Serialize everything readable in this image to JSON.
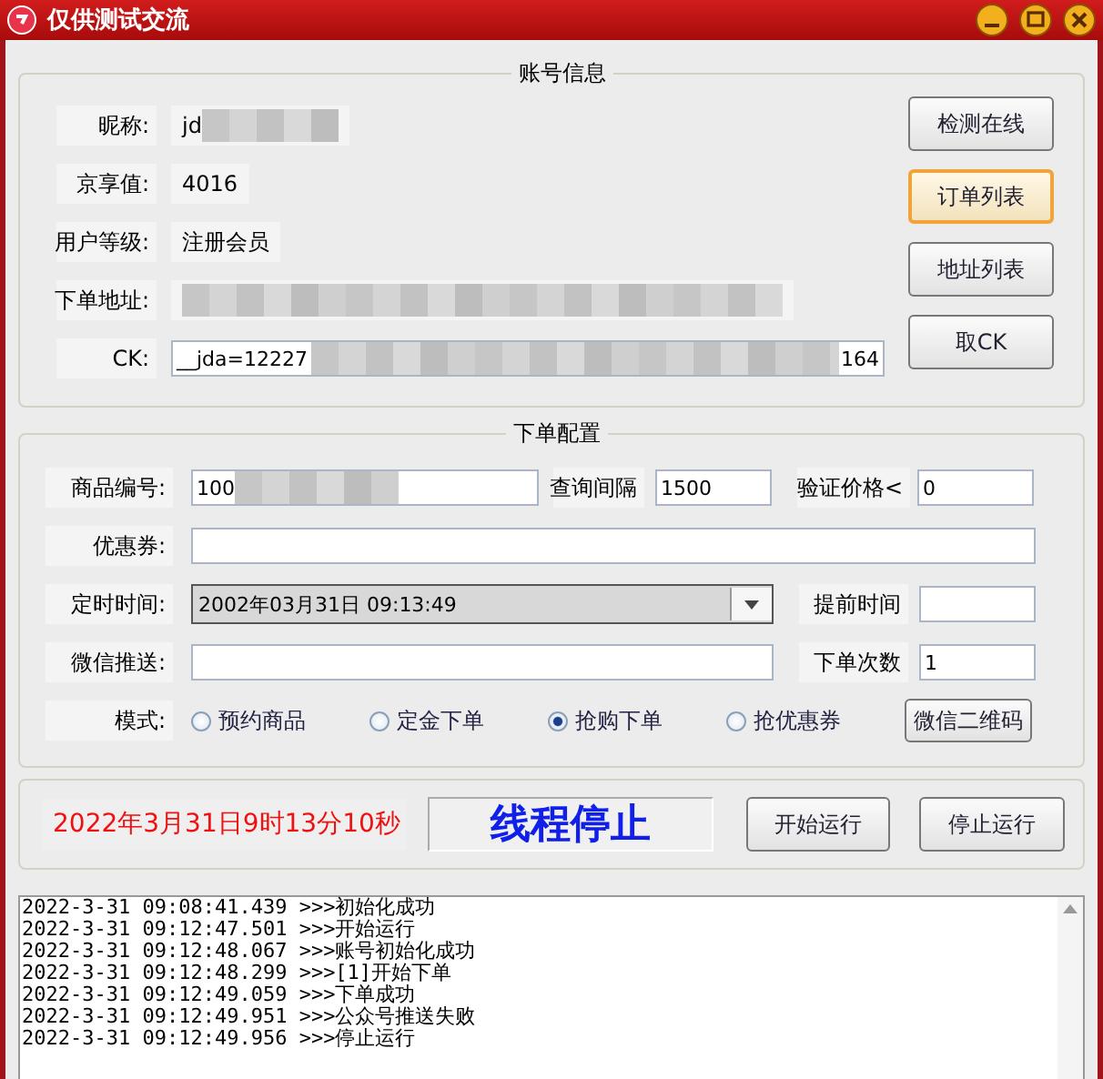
{
  "window": {
    "title": "仅供测试交流"
  },
  "account": {
    "title": "账号信息",
    "fields": [
      {
        "kind": "text",
        "label": "昵称:",
        "value": "jd",
        "redacted": true
      },
      {
        "kind": "text",
        "label": "京享值:",
        "value": "4016",
        "redacted": false
      },
      {
        "kind": "text",
        "label": "用户等级:",
        "value": "注册会员",
        "redacted": false
      },
      {
        "kind": "text",
        "label": "下单地址:",
        "redacted": true
      },
      {
        "kind": "input",
        "label": "CK:",
        "value": "__jda=12227",
        "value_end": "164",
        "redacted": true
      }
    ],
    "buttons": [
      {
        "label": "检测在线",
        "focused": false
      },
      {
        "label": "订单列表",
        "focused": true
      },
      {
        "label": "地址列表",
        "focused": false
      },
      {
        "label": "取CK",
        "focused": false
      }
    ]
  },
  "order": {
    "title": "下单配置",
    "product": {
      "label": "商品编号:",
      "value": "100",
      "redacted": true
    },
    "interval": {
      "label": "查询间隔",
      "value": "1500"
    },
    "price": {
      "label": "验证价格<",
      "value": "0"
    },
    "coupon": {
      "label": "优惠券:"
    },
    "timer": {
      "label": "定时时间:",
      "value": "2002年03月31日 09:13:49"
    },
    "advance": {
      "label": "提前时间"
    },
    "wechat": {
      "label": "微信推送:"
    },
    "count": {
      "label": "下单次数",
      "value": "1"
    },
    "mode": {
      "label": "模式:",
      "options": [
        {
          "label": "预约商品",
          "selected": false
        },
        {
          "label": "定金下单",
          "selected": false
        },
        {
          "label": "抢购下单",
          "selected": true
        },
        {
          "label": "抢优惠券",
          "selected": false
        }
      ]
    },
    "qr_button": "微信二维码"
  },
  "run": {
    "clock": "2022年3月31日9时13分10秒",
    "status": "线程停止",
    "buttons": [
      "开始运行",
      "停止运行"
    ]
  },
  "log": [
    "2022-3-31 09:08:41.439 >>>初始化成功",
    "2022-3-31 09:12:47.501 >>>开始运行",
    "2022-3-31 09:12:48.067 >>>账号初始化成功",
    "2022-3-31 09:12:48.299 >>>[1]开始下单",
    "2022-3-31 09:12:49.059 >>>下单成功",
    "2022-3-31 09:12:49.951 >>>公众号推送失败",
    "2022-3-31 09:12:49.956 >>>停止运行"
  ]
}
